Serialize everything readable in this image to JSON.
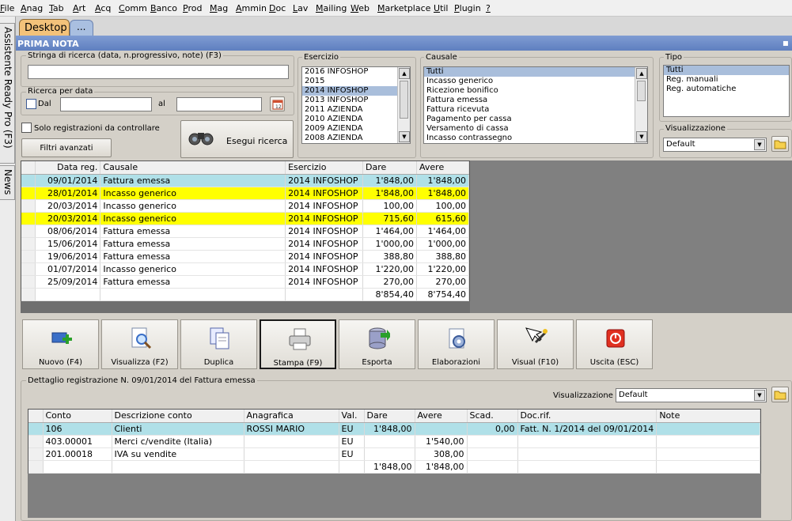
{
  "menu": [
    "File",
    "Anag",
    "Tab",
    "Art",
    "Acq",
    "Comm",
    "Banco",
    "Prod",
    "Mag",
    "Ammin",
    "Doc",
    "Lav",
    "Mailing",
    "Web",
    "Marketplace",
    "Util",
    "Plugin",
    "?"
  ],
  "sidebar": {
    "tab1": "Assistente Ready Pro (F3)",
    "tab2": "News"
  },
  "tabs": {
    "desktop": "Desktop",
    "more": "..."
  },
  "window": {
    "title": "PRIMA NOTA",
    "close": "▪"
  },
  "search": {
    "label": "Stringa di ricerca (data, n.progressivo, note) (F3)",
    "value": ""
  },
  "ricerca_data": {
    "label": "Ricerca per data",
    "dal": "Dal",
    "al": "al",
    "dal_value": "",
    "al_value": ""
  },
  "solo_label": "Solo registrazioni da controllare",
  "filtri_label": "Filtri avanzati",
  "esegui_label": "Esegui ricerca",
  "esercizio": {
    "label": "Esercizio",
    "items": [
      "2016 INFOSHOP",
      "2015",
      "2014 INFOSHOP",
      "2013 INFOSHOP",
      "2011 AZIENDA",
      "2010 AZIENDA",
      "2009 AZIENDA",
      "2008 AZIENDA"
    ],
    "selected": 2
  },
  "causale": {
    "label": "Causale",
    "items": [
      "Tutti",
      "Incasso generico",
      "Ricezione bonifico",
      "Fattura emessa",
      "Fattura ricevuta",
      "Pagamento per cassa",
      "Versamento di cassa",
      "Incasso contrassegno"
    ],
    "selected": 0
  },
  "tipo": {
    "label": "Tipo",
    "items": [
      "Tutti",
      "Reg. manuali",
      "Reg. automatiche"
    ],
    "selected": 0
  },
  "visualizzazione": {
    "label": "Visualizzazione",
    "value": "Default"
  },
  "main_table": {
    "headers": [
      "Data reg.",
      "Causale",
      "Esercizio",
      "Dare",
      "Avere"
    ],
    "rows": [
      {
        "data": "09/01/2014",
        "causale": "Fattura emessa",
        "esercizio": "2014 INFOSHOP",
        "dare": "1'848,00",
        "avere": "1'848,00",
        "style": "cyan"
      },
      {
        "data": "28/01/2014",
        "causale": "Incasso generico",
        "esercizio": "2014 INFOSHOP",
        "dare": "1'848,00",
        "avere": "1'848,00",
        "style": "yellow"
      },
      {
        "data": "20/03/2014",
        "causale": "Incasso generico",
        "esercizio": "2014 INFOSHOP",
        "dare": "100,00",
        "avere": "100,00",
        "style": ""
      },
      {
        "data": "20/03/2014",
        "causale": "Incasso generico",
        "esercizio": "2014 INFOSHOP",
        "dare": "715,60",
        "avere": "615,60",
        "style": "yellow"
      },
      {
        "data": "08/06/2014",
        "causale": "Fattura emessa",
        "esercizio": "2014 INFOSHOP",
        "dare": "1'464,00",
        "avere": "1'464,00",
        "style": ""
      },
      {
        "data": "15/06/2014",
        "causale": "Fattura emessa",
        "esercizio": "2014 INFOSHOP",
        "dare": "1'000,00",
        "avere": "1'000,00",
        "style": ""
      },
      {
        "data": "19/06/2014",
        "causale": "Fattura emessa",
        "esercizio": "2014 INFOSHOP",
        "dare": "388,80",
        "avere": "388,80",
        "style": ""
      },
      {
        "data": "01/07/2014",
        "causale": "Incasso generico",
        "esercizio": "2014 INFOSHOP",
        "dare": "1'220,00",
        "avere": "1'220,00",
        "style": ""
      },
      {
        "data": "25/09/2014",
        "causale": "Fattura emessa",
        "esercizio": "2014 INFOSHOP",
        "dare": "270,00",
        "avere": "270,00",
        "style": ""
      }
    ],
    "total_dare": "8'854,40",
    "total_avere": "8'754,40"
  },
  "toolbar": [
    {
      "label": "Nuovo (F4)",
      "icon": "new-icon"
    },
    {
      "label": "Visualizza (F2)",
      "icon": "view-icon"
    },
    {
      "label": "Duplica",
      "icon": "duplicate-icon"
    },
    {
      "label": "Stampa (F9)",
      "icon": "print-icon"
    },
    {
      "label": "Esporta",
      "icon": "export-icon"
    },
    {
      "label": "Elaborazioni",
      "icon": "process-icon"
    },
    {
      "label": "Visual (F10)",
      "icon": "wand-icon"
    },
    {
      "label": "Uscita (ESC)",
      "icon": "exit-icon"
    }
  ],
  "detail": {
    "label": "Dettaglio registrazione N. 09/01/2014 del Fattura emessa",
    "vis_label": "Visualizzazione :",
    "vis_value": "Default",
    "headers": [
      "Conto",
      "Descrizione conto",
      "Anagrafica",
      "Val.",
      "Dare",
      "Avere",
      "Scad.",
      "Doc.rif.",
      "Note"
    ],
    "rows": [
      {
        "conto": "106",
        "desc": "Clienti",
        "anag": "ROSSI MARIO",
        "val": "EU",
        "dare": "1'848,00",
        "avere": "",
        "scad": "0,00",
        "doc": "Fatt. N. 1/2014 del 09/01/2014",
        "note": "",
        "style": "cyan"
      },
      {
        "conto": "403.00001",
        "desc": "Merci c/vendite (Italia)",
        "anag": "",
        "val": "EU",
        "dare": "",
        "avere": "1'540,00",
        "scad": "",
        "doc": "",
        "note": "",
        "style": ""
      },
      {
        "conto": "201.00018",
        "desc": "IVA su vendite",
        "anag": "",
        "val": "EU",
        "dare": "",
        "avere": "308,00",
        "scad": "",
        "doc": "",
        "note": "",
        "style": ""
      }
    ],
    "total_dare": "1'848,00",
    "total_avere": "1'848,00"
  },
  "colors": {
    "highlight_cyan": "#b0e0e8",
    "highlight_yellow": "#ffff00",
    "title_blue": "#6a89c8",
    "tab_orange": "#f3c27a"
  }
}
